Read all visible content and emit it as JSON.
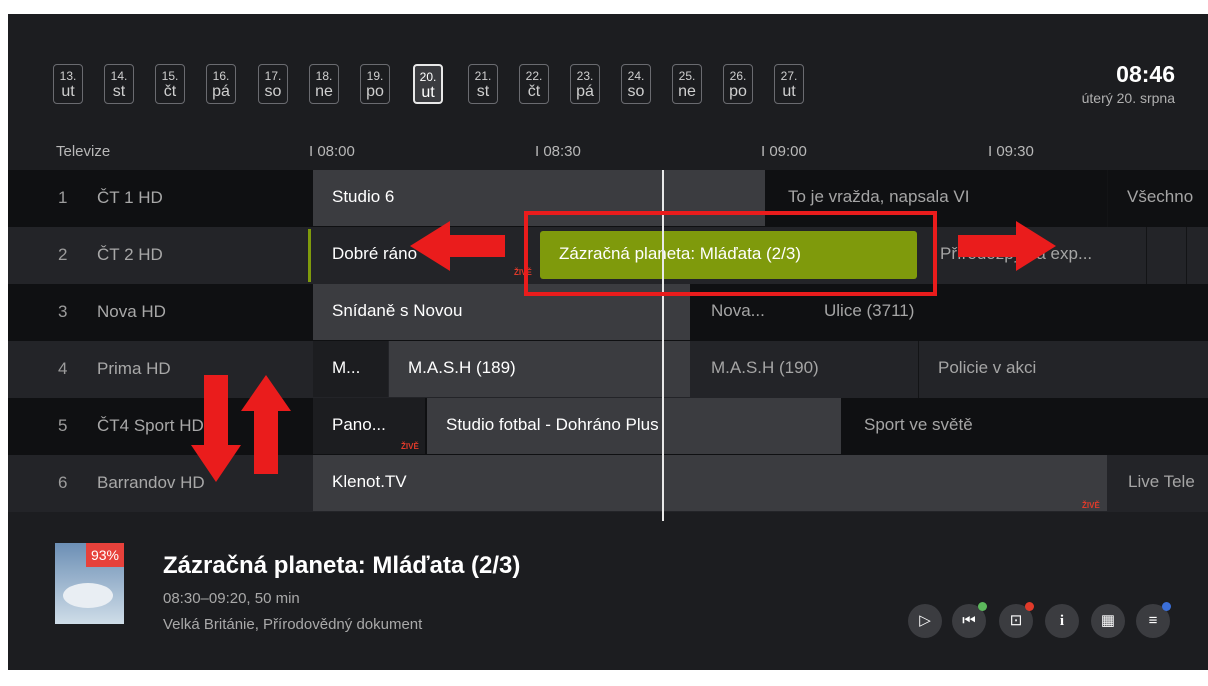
{
  "dates": [
    {
      "day": "13.",
      "weekday": "ut"
    },
    {
      "day": "14.",
      "weekday": "st"
    },
    {
      "day": "15.",
      "weekday": "čt"
    },
    {
      "day": "16.",
      "weekday": "pá"
    },
    {
      "day": "17.",
      "weekday": "so"
    },
    {
      "day": "18.",
      "weekday": "ne"
    },
    {
      "day": "19.",
      "weekday": "po"
    },
    {
      "day": "20.",
      "weekday": "ut",
      "selected": true
    },
    {
      "day": "21.",
      "weekday": "st"
    },
    {
      "day": "22.",
      "weekday": "čt"
    },
    {
      "day": "23.",
      "weekday": "pá"
    },
    {
      "day": "24.",
      "weekday": "so"
    },
    {
      "day": "25.",
      "weekday": "ne"
    },
    {
      "day": "26.",
      "weekday": "po"
    },
    {
      "day": "27.",
      "weekday": "ut"
    }
  ],
  "clock": {
    "time": "08:46",
    "date": "úterý 20. srpna"
  },
  "header": {
    "section": "Televize",
    "ticks": [
      "I 08:00",
      "I 08:30",
      "I 09:00",
      "I 09:30"
    ]
  },
  "channels": [
    {
      "num": "1",
      "name": "ČT 1 HD",
      "programs": [
        "Studio 6",
        "To je vražda, napsala VI",
        "Všechno"
      ]
    },
    {
      "num": "2",
      "name": "ČT 2 HD",
      "programs": [
        "Dobré ráno",
        "Zázračná planeta: Mláďata (2/3)",
        "Přírodozpytná exp..."
      ]
    },
    {
      "num": "3",
      "name": "Nova HD",
      "programs": [
        "Snídaně s Novou",
        "Nova...",
        "Ulice (3711)"
      ]
    },
    {
      "num": "4",
      "name": "Prima HD",
      "programs": [
        "M...",
        "M.A.S.H (189)",
        "M.A.S.H (190)",
        "Policie v akci"
      ]
    },
    {
      "num": "5",
      "name": "ČT4 Sport HD",
      "programs": [
        "Pano...",
        "Studio fotbal - Dohráno Plus",
        "Sport ve světě"
      ]
    },
    {
      "num": "6",
      "name": "Barrandov HD",
      "programs": [
        "Klenot.TV",
        "Live Tele"
      ]
    }
  ],
  "live_label": "ŽIVĚ",
  "detail": {
    "progress": "93%",
    "title": "Zázračná planeta: Mláďata (2/3)",
    "time": "08:30–09:20, 50 min",
    "info": "Velká Británie, Přírodovědný dokument"
  },
  "controls": [
    {
      "icon": "play-icon",
      "glyph": "▷"
    },
    {
      "icon": "restart-icon",
      "glyph": "⏮",
      "dot": "#5cb85c"
    },
    {
      "icon": "record-icon",
      "glyph": "⊡",
      "dot": "#e03a2a"
    },
    {
      "icon": "info-icon",
      "glyph": "i"
    },
    {
      "icon": "calendar-icon",
      "glyph": "▦"
    },
    {
      "icon": "menu-icon",
      "glyph": "≡",
      "dot": "#3b6fd8"
    }
  ],
  "colors": {
    "accent": "#7f9a0c",
    "annotation": "#ea1c1c",
    "background": "#1c1d20"
  }
}
